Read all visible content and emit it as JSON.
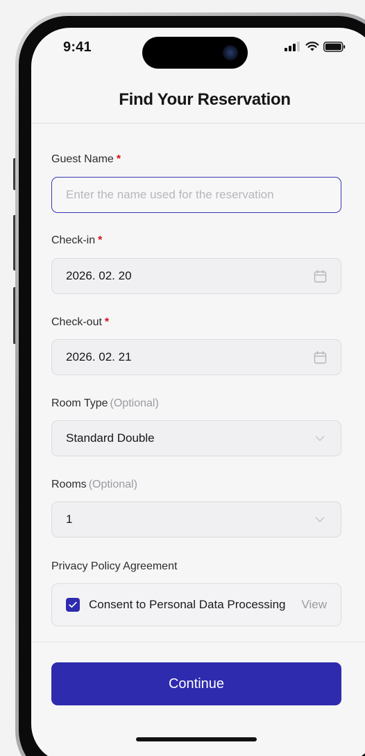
{
  "status_bar": {
    "time": "9:41",
    "icons": [
      "signal-icon",
      "wifi-icon",
      "battery-icon"
    ]
  },
  "header": {
    "title": "Find Your Reservation"
  },
  "form": {
    "guest_name": {
      "label": "Guest Name",
      "required_mark": "*",
      "value": "",
      "placeholder": "Enter the name used for the reservation"
    },
    "check_in": {
      "label": "Check-in",
      "required_mark": "*",
      "value": "2026. 02. 20",
      "icon": "calendar-icon"
    },
    "check_out": {
      "label": "Check-out",
      "required_mark": "*",
      "value": "2026. 02. 21",
      "icon": "calendar-icon"
    },
    "room_type": {
      "label": "Room Type",
      "optional_text": "(Optional)",
      "value": "Standard Double",
      "icon": "chevron-down-icon"
    },
    "rooms": {
      "label": "Rooms",
      "optional_text": "(Optional)",
      "value": "1",
      "icon": "chevron-down-icon"
    },
    "privacy": {
      "label": "Privacy Policy Agreement",
      "consent_text": "Consent to Personal Data Processing",
      "consent_checked": true,
      "view_link": "View"
    }
  },
  "footer": {
    "continue_label": "Continue"
  },
  "colors": {
    "primary": "#2e2baf",
    "required": "#d4111b",
    "muted": "#9a9aa0",
    "background": "#f6f6f7"
  }
}
